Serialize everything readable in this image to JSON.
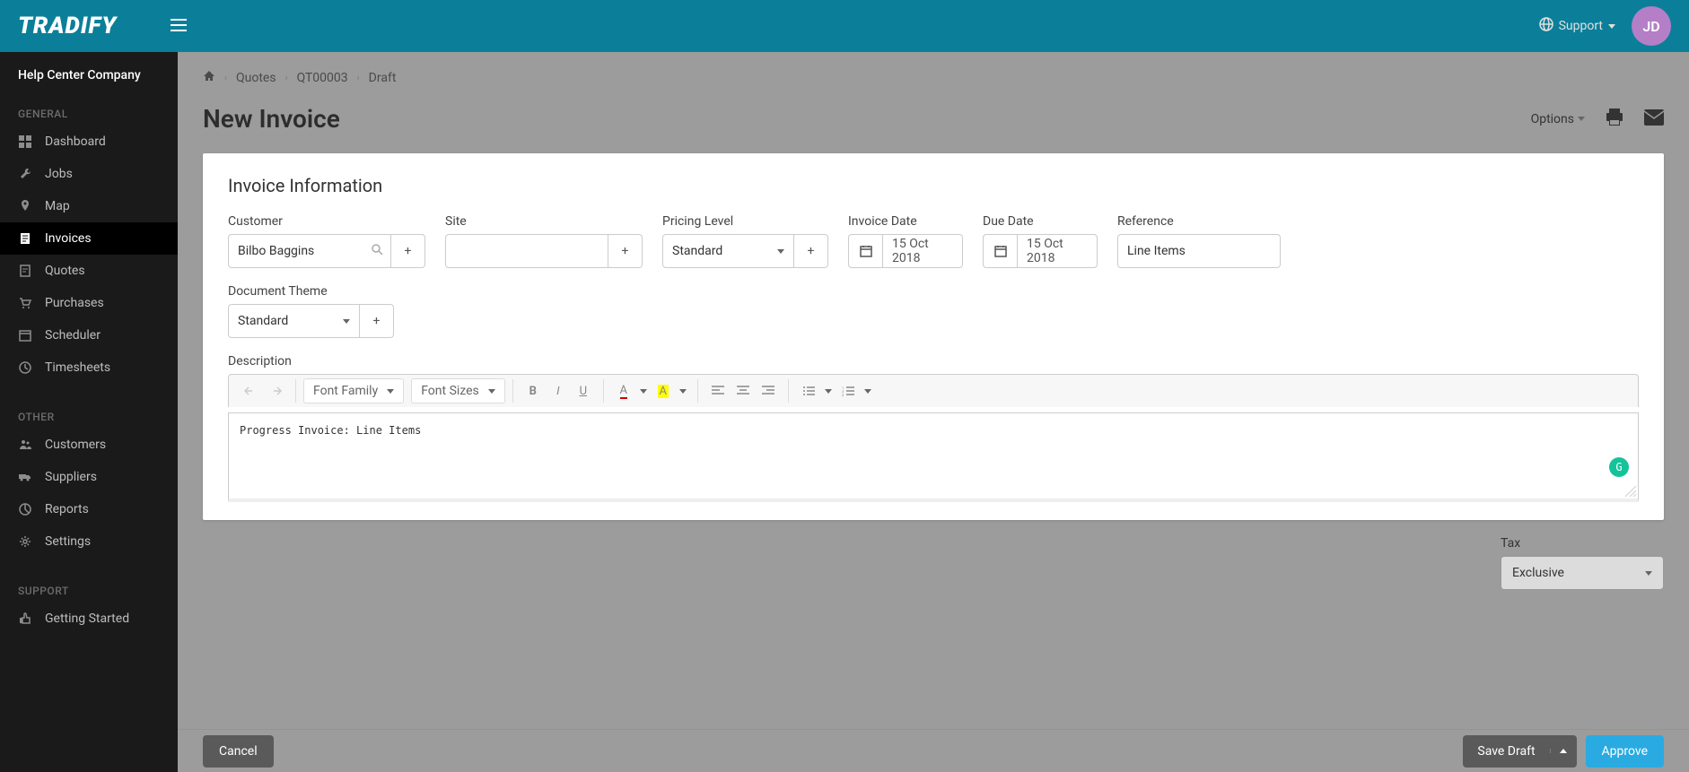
{
  "brand": "TRADIFY",
  "header": {
    "support": "Support",
    "avatar_initials": "JD"
  },
  "sidebar": {
    "company": "Help Center Company",
    "sections": {
      "general": "GENERAL",
      "other": "OTHER",
      "support": "SUPPORT"
    },
    "general_items": [
      {
        "label": "Dashboard",
        "id": "dashboard"
      },
      {
        "label": "Jobs",
        "id": "jobs"
      },
      {
        "label": "Map",
        "id": "map"
      },
      {
        "label": "Invoices",
        "id": "invoices",
        "active": true
      },
      {
        "label": "Quotes",
        "id": "quotes"
      },
      {
        "label": "Purchases",
        "id": "purchases"
      },
      {
        "label": "Scheduler",
        "id": "scheduler"
      },
      {
        "label": "Timesheets",
        "id": "timesheets"
      }
    ],
    "other_items": [
      {
        "label": "Customers",
        "id": "customers"
      },
      {
        "label": "Suppliers",
        "id": "suppliers"
      },
      {
        "label": "Reports",
        "id": "reports"
      },
      {
        "label": "Settings",
        "id": "settings"
      }
    ],
    "support_items": [
      {
        "label": "Getting Started",
        "id": "getting-started"
      }
    ]
  },
  "breadcrumb": {
    "quotes": "Quotes",
    "quote_number": "QT00003",
    "status": "Draft"
  },
  "page": {
    "title": "New Invoice",
    "options": "Options"
  },
  "card": {
    "title": "Invoice Information",
    "labels": {
      "customer": "Customer",
      "site": "Site",
      "pricing_level": "Pricing Level",
      "invoice_date": "Invoice Date",
      "due_date": "Due Date",
      "reference": "Reference",
      "document_theme": "Document Theme",
      "description": "Description"
    },
    "values": {
      "customer": "Bilbo Baggins",
      "site": "",
      "pricing_level": "Standard",
      "invoice_date": "15 Oct 2018",
      "due_date": "15 Oct 2018",
      "reference": "Line Items",
      "document_theme": "Standard",
      "description_text": "Progress Invoice: Line Items"
    },
    "editor": {
      "font_family": "Font Family",
      "font_sizes": "Font Sizes"
    }
  },
  "tax": {
    "label": "Tax",
    "value": "Exclusive"
  },
  "footer": {
    "cancel": "Cancel",
    "save_draft": "Save Draft",
    "approve": "Approve"
  }
}
